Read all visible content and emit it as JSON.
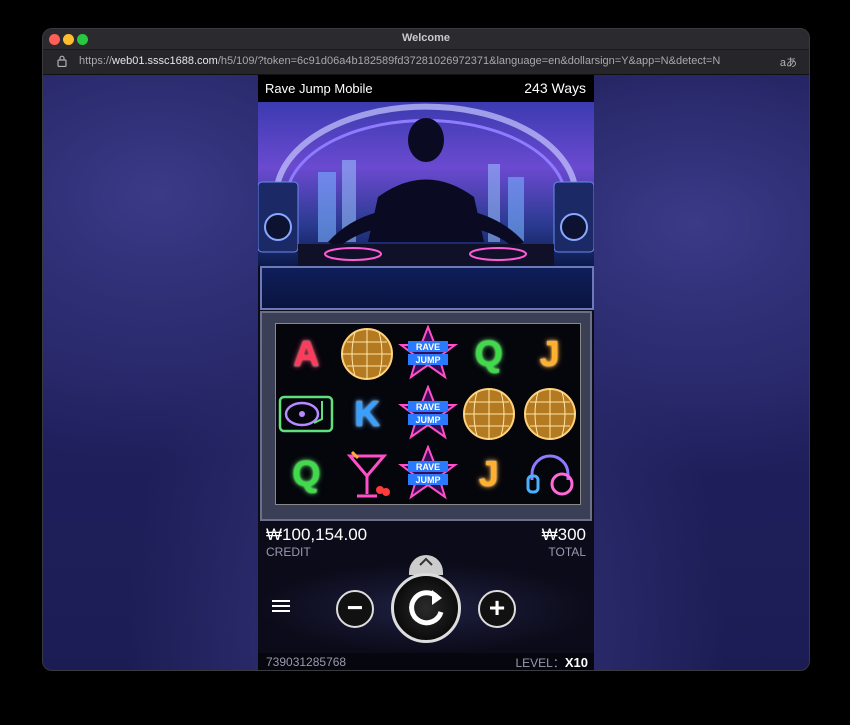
{
  "window": {
    "title": "Welcome"
  },
  "browser": {
    "url_prefix": "https://",
    "url_host": "web01.sssc1688.com",
    "url_rest": "/h5/109/?token=6c91d06a4b182589fd37281026972371&language=en&dollarsign=Y&app=N&detect=N",
    "translate_icon": "aあ"
  },
  "game": {
    "title": "Rave Jump Mobile",
    "ways": "243 Ways",
    "reels": [
      [
        {
          "t": "A",
          "c": "#ff3b5b"
        },
        {
          "t": "disco",
          "c": "#e0a040"
        },
        {
          "t": "RAVE JUMP",
          "c": "#ffffff"
        },
        {
          "t": "Q",
          "c": "#3fdc4a"
        },
        {
          "t": "J",
          "c": "#ffb030"
        }
      ],
      [
        {
          "t": "turntable",
          "c": "#5fe07a"
        },
        {
          "t": "K",
          "c": "#3aa0ff"
        },
        {
          "t": "RAVE JUMP",
          "c": "#ffffff"
        },
        {
          "t": "disco",
          "c": "#e0a040"
        },
        {
          "t": "disco",
          "c": "#e0a040"
        }
      ],
      [
        {
          "t": "Q",
          "c": "#3fdc4a"
        },
        {
          "t": "cocktail",
          "c": "#ff4fc8"
        },
        {
          "t": "RAVE JUMP",
          "c": "#ffffff"
        },
        {
          "t": "J",
          "c": "#ffb030"
        },
        {
          "t": "headphones",
          "c": "#8a7bff"
        }
      ]
    ],
    "credit_value": "₩100,154.00",
    "credit_label": "CREDIT",
    "total_value": "₩300",
    "total_label": "TOTAL",
    "serial": "739031285768",
    "level_label": "LEVEL：",
    "level_value": "X10"
  },
  "icons": [
    "lock-icon",
    "menu-icon",
    "minus-icon",
    "spin-icon",
    "plus-icon",
    "chevron-up-icon"
  ]
}
